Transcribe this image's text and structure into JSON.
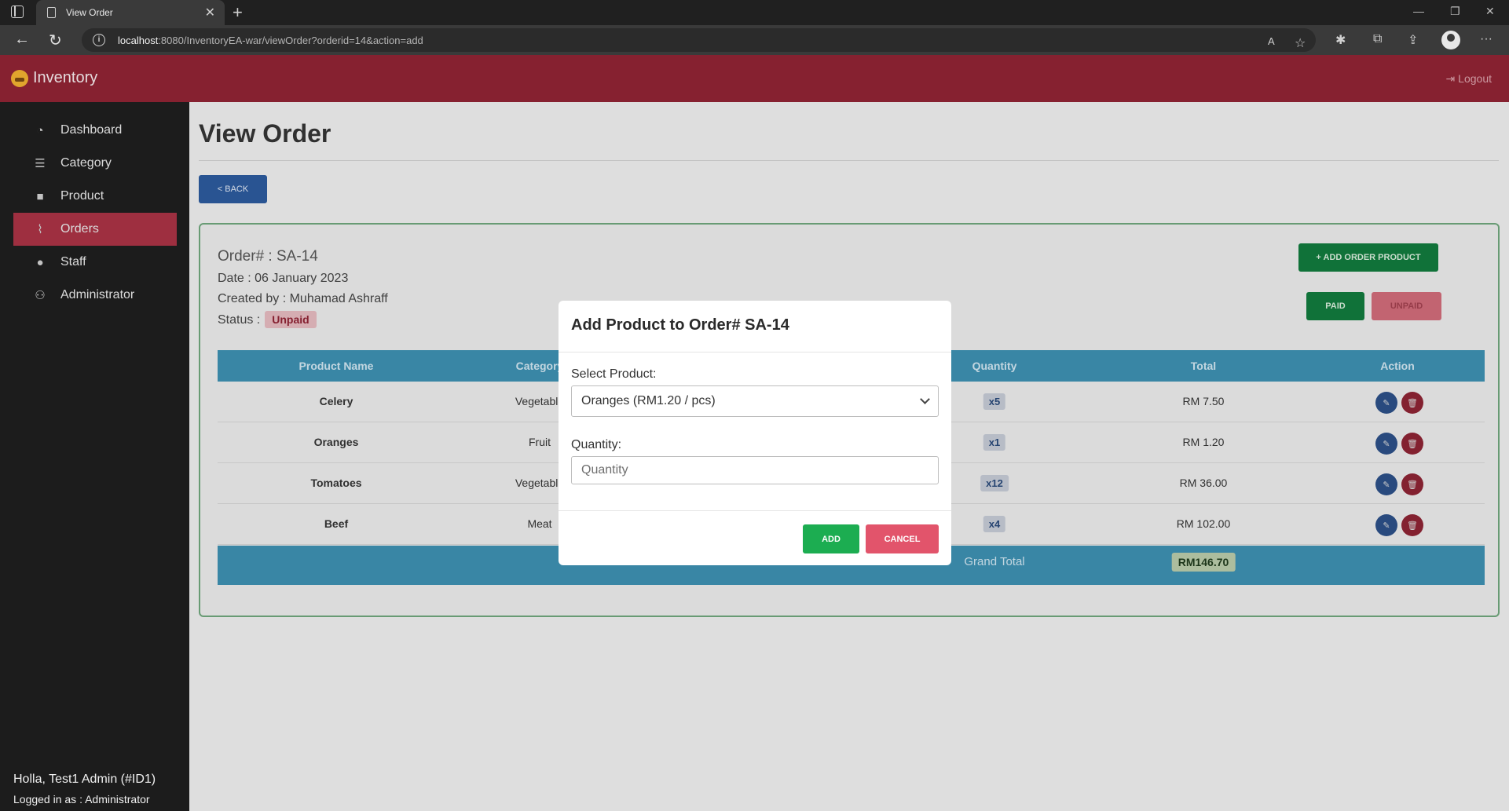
{
  "browser": {
    "tab_title": "View Order",
    "url_host": "localhost",
    "url_rest": ":8080/InventoryEA-war/viewOrder?orderid=14&action=add"
  },
  "navbar": {
    "brand": "Inventory",
    "logout": "Logout"
  },
  "sidebar": {
    "items": [
      {
        "label": "Dashboard",
        "icon": "dashboard-icon"
      },
      {
        "label": "Category",
        "icon": "list-icon"
      },
      {
        "label": "Product",
        "icon": "box-icon"
      },
      {
        "label": "Orders",
        "icon": "chart-icon",
        "active": true
      },
      {
        "label": "Staff",
        "icon": "user-icon"
      },
      {
        "label": "Administrator",
        "icon": "user-admin-icon"
      }
    ],
    "greeting": "Holla, Test1 Admin (#ID1)",
    "logged_in": "Logged in as : Administrator"
  },
  "page": {
    "title": "View Order",
    "back_label": "< BACK"
  },
  "order": {
    "number": "Order# : SA-14",
    "date": "Date : 06 January 2023",
    "created_by": "Created by : Muhamad Ashraff",
    "status_label": "Status :",
    "status_value": "Unpaid",
    "add_product_label": "+ ADD ORDER PRODUCT",
    "paid_label": "PAID",
    "unpaid_label": "UNPAID"
  },
  "table": {
    "headers": [
      "Product Name",
      "Category",
      "Quantity",
      "Total",
      "Action"
    ],
    "rows": [
      {
        "name": "Celery",
        "category": "Vegetable",
        "qty": "x5",
        "total": "RM 7.50"
      },
      {
        "name": "Oranges",
        "category": "Fruit",
        "qty": "x1",
        "total": "RM 1.20"
      },
      {
        "name": "Tomatoes",
        "category": "Vegetable",
        "qty": "x12",
        "total": "RM 36.00"
      },
      {
        "name": "Beef",
        "category": "Meat",
        "qty": "x4",
        "total": "RM 102.00"
      }
    ],
    "grand_total_label": "Grand Total",
    "grand_total_value": "RM146.70"
  },
  "modal": {
    "title": "Add Product to Order# SA-14",
    "select_label": "Select Product:",
    "select_value": "Oranges (RM1.20 / pcs)",
    "quantity_label": "Quantity:",
    "quantity_placeholder": "Quantity",
    "add_label": "ADD",
    "cancel_label": "CANCEL"
  },
  "colors": {
    "navbar": "#8f2433",
    "sidebar_active": "#a83244",
    "table_header": "#3d8fb0",
    "success": "#127a3d",
    "modal_add": "#1cad51",
    "modal_cancel": "#e2546b"
  }
}
